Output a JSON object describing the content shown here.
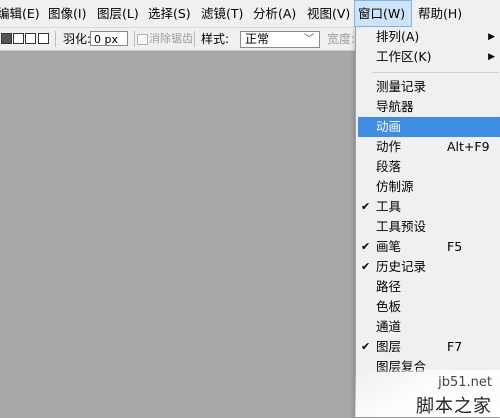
{
  "menubar": {
    "items": [
      {
        "label": "编辑(E)"
      },
      {
        "label": "图像(I)"
      },
      {
        "label": "图层(L)"
      },
      {
        "label": "选择(S)"
      },
      {
        "label": "滤镜(T)"
      },
      {
        "label": "分析(A)"
      },
      {
        "label": "视图(V)"
      },
      {
        "label": "窗口(W)"
      },
      {
        "label": "帮助(H)"
      }
    ]
  },
  "options": {
    "feather_label": "羽化:",
    "feather_value": "0 px",
    "antialias_label": "消除锯齿",
    "style_label": "样式:",
    "style_value": "正常",
    "width_label": "宽度:"
  },
  "window_menu": {
    "items": [
      {
        "label": "排列(A)",
        "submenu": true
      },
      {
        "label": "工作区(K)",
        "submenu": true
      },
      {
        "label": "测量记录"
      },
      {
        "label": "导航器"
      },
      {
        "label": "动画",
        "highlighted": true
      },
      {
        "label": "动作",
        "shortcut": "Alt+F9"
      },
      {
        "label": "段落"
      },
      {
        "label": "仿制源"
      },
      {
        "label": "工具",
        "checked": true
      },
      {
        "label": "工具预设"
      },
      {
        "label": "画笔",
        "checked": true,
        "shortcut": "F5"
      },
      {
        "label": "历史记录",
        "checked": true
      },
      {
        "label": "路径"
      },
      {
        "label": "色板"
      },
      {
        "label": "通道"
      },
      {
        "label": "图层",
        "checked": true,
        "shortcut": "F7"
      },
      {
        "label": "图层复合"
      }
    ]
  },
  "watermark": {
    "line1": "jb51.net",
    "line2": "脚本之家"
  },
  "colors": {
    "highlight": "#3d8ee3",
    "canvas": "#a8a8a8",
    "menu_bg": "#f0f0f0"
  }
}
